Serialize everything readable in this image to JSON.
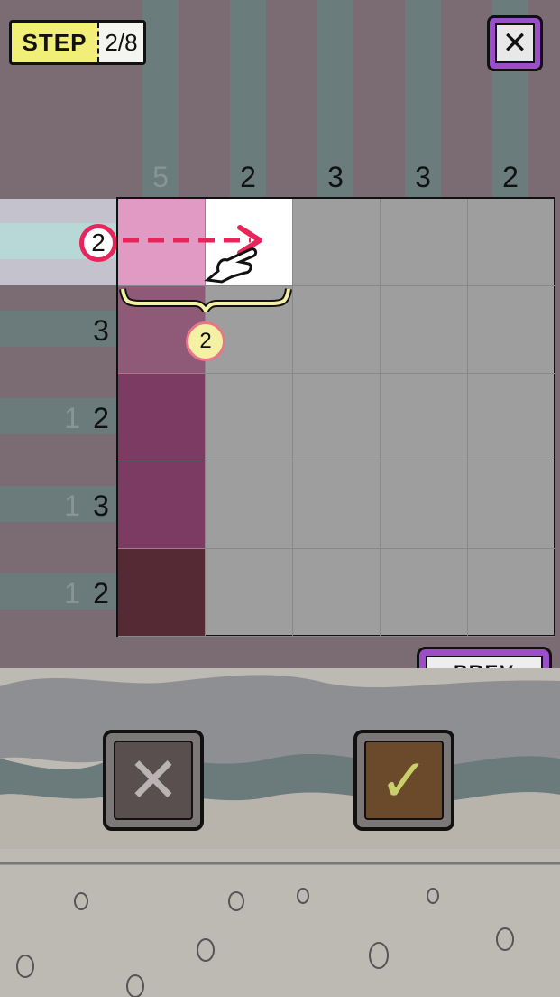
{
  "header": {
    "step_label": "STEP",
    "step_value": "2/8",
    "close_icon": "close-icon"
  },
  "column_clues": [
    {
      "value": "5",
      "dim": true
    },
    {
      "value": "2",
      "dim": false
    },
    {
      "value": "3",
      "dim": false
    },
    {
      "value": "3",
      "dim": false
    },
    {
      "value": "2",
      "dim": false
    }
  ],
  "row_clues": [
    {
      "dim": "",
      "value": "2"
    },
    {
      "dim": "",
      "value": "3"
    },
    {
      "dim": "1",
      "value": "2"
    },
    {
      "dim": "1",
      "value": "3"
    },
    {
      "dim": "1",
      "value": "2"
    }
  ],
  "hint": {
    "row_clue": "2",
    "bracket_count": "2",
    "hand_icon": "pointing-hand-icon",
    "arrow_icon": "arrow-right-icon"
  },
  "colors": {
    "column_1": [
      "#e09ac4",
      "#8f5a78",
      "#7c3b62",
      "#7c3b62",
      "#552a35"
    ],
    "highlight_cell": "#ffffff",
    "accent": "#e8245a",
    "purple": "#9a4fc9"
  },
  "buttons": {
    "prev": "PREV",
    "cross_icon": "cross-icon",
    "check_icon": "check-icon"
  }
}
